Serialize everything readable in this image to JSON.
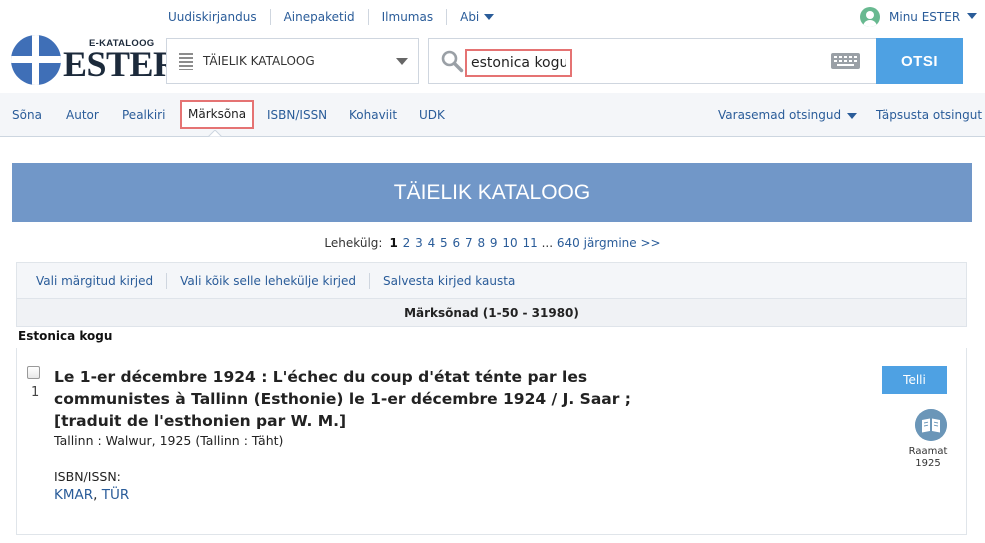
{
  "topnav": {
    "links": [
      "Uudiskirjandus",
      "Ainepaketid",
      "Ilmumas",
      "Abi"
    ],
    "user": "Minu ESTER"
  },
  "logo": {
    "small": "E-KATALOOG",
    "big": "ESTER"
  },
  "search": {
    "catalog": "TÄIELIK KATALOOG",
    "query": "estonica kogu",
    "button": "OTSI"
  },
  "tabs": {
    "items": [
      "Sõna",
      "Autor",
      "Pealkiri",
      "Märksõna",
      "ISBN/ISSN",
      "Kohaviit",
      "UDK"
    ],
    "active": "Märksõna",
    "previous": "Varasemad otsingud",
    "refine": "Täpsusta otsingut"
  },
  "banner": {
    "title": "TÄIELIK KATALOOG"
  },
  "pager": {
    "label": "Lehekülg:",
    "current": "1",
    "pages": [
      "2",
      "3",
      "4",
      "5",
      "6",
      "7",
      "8",
      "9",
      "10",
      "11"
    ],
    "ellipsis": "...",
    "last": "640",
    "next": "järgmine >>"
  },
  "actions": [
    "Vali märgitud kirjed",
    "Vali kõik selle lehekülje kirjed",
    "Salvesta kirjed kausta"
  ],
  "results": {
    "header": "Märksõnad (1-50 - 31980)",
    "group": "Estonica kogu"
  },
  "record": {
    "number": "1",
    "title": "Le 1-er décembre 1924 : L'échec du coup d'état ténte par les communistes à Tallinn (Esthonie) le 1-er décembre 1924 / J. Saar ; [traduit de l'esthonien par W. M.]",
    "publication": "Tallinn : Walwur, 1925 (Tallinn : Täht)",
    "isbn_label": "ISBN/ISSN:",
    "links": [
      "KMAR",
      "TÜR"
    ],
    "order_button": "Telli",
    "type": "Raamat",
    "year": "1925"
  },
  "colors": {
    "accent": "#4ea1e3",
    "banner": "#7197c8",
    "link": "#2a5c99",
    "highlight": "#e57373"
  }
}
